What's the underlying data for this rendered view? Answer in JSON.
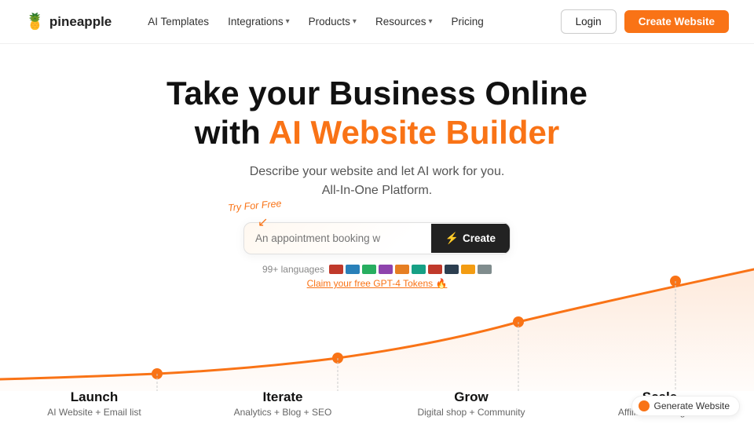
{
  "nav": {
    "logo_text": "pineapple",
    "links": [
      {
        "label": "AI Templates",
        "has_dropdown": false
      },
      {
        "label": "Integrations",
        "has_dropdown": true
      },
      {
        "label": "Products",
        "has_dropdown": true
      },
      {
        "label": "Resources",
        "has_dropdown": true
      },
      {
        "label": "Pricing",
        "has_dropdown": false
      }
    ],
    "login_label": "Login",
    "create_label": "Create Website"
  },
  "hero": {
    "title_line1": "Take your Business Online",
    "title_line2_normal": "with ",
    "title_line2_orange": "AI Website Builder",
    "subtitle_line1": "Describe your website and let AI work for you.",
    "subtitle_line2": "All-In-One Platform.",
    "try_label": "Try For Free",
    "input_placeholder": "An appointment booking w",
    "create_button": "Create",
    "languages_text": "99+ languages",
    "claim_text": "Claim your free GPT-4 Tokens 🔥"
  },
  "stages": [
    {
      "name": "Launch",
      "desc": "AI Website + Email list"
    },
    {
      "name": "Iterate",
      "desc": "Analytics + Blog + SEO"
    },
    {
      "name": "Grow",
      "desc": "Digital shop + Community"
    },
    {
      "name": "Scale",
      "desc": "Affiliates + Integrate"
    }
  ],
  "generate_badge": "Generate Website"
}
